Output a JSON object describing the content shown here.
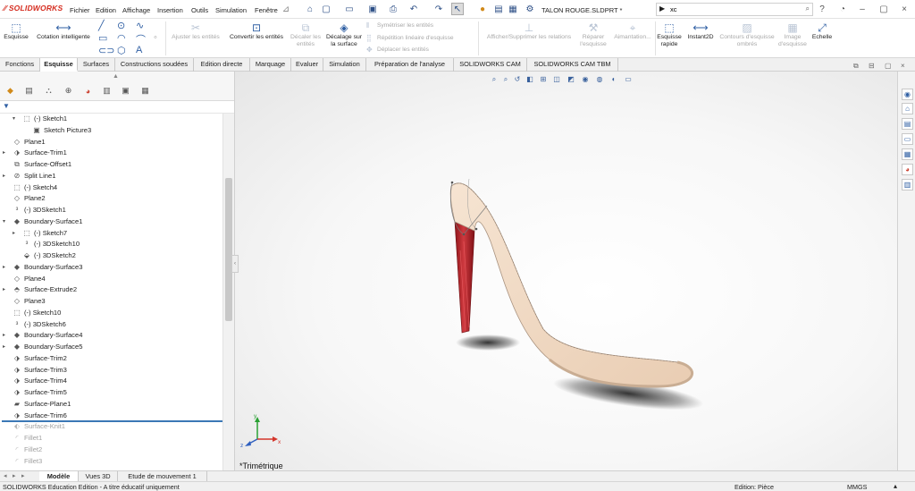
{
  "app": {
    "logo": "SOLIDWORKS",
    "document_title": "TALON ROUGE.SLDPRT *"
  },
  "menu": [
    "Fichier",
    "Edition",
    "Affichage",
    "Insertion",
    "Outils",
    "Simulation",
    "Fenêtre"
  ],
  "search": {
    "value": "xc",
    "placeholder": ""
  },
  "ribbon": {
    "esquisse": "Esquisse",
    "cotation": "Cotation intelligente",
    "ajuster": "Ajuster les entités",
    "convertir": "Convertir les entités",
    "decaler_entites": "Décaler les entités",
    "decalage_surface": "Décalage sur la surface",
    "symetriser": "Symétriser les entités",
    "repetition": "Répétition linéaire d'esquisse",
    "deplacer": "Déplacer les entités",
    "afficher_relations": "Afficher/Supprimer les relations",
    "reparer": "Réparer l'esquisse",
    "aimantation": "Aimantation...",
    "esquisse_rapide": "Esquisse rapide",
    "instant2d": "Instant2D",
    "contours": "Contours d'esquisse ombrés",
    "image_esquisse": "Image d'esquisse",
    "echelle": "Echelle"
  },
  "tabs": [
    "Fonctions",
    "Esquisse",
    "Surfaces",
    "Constructions soudées",
    "Edition directe",
    "Marquage",
    "Evaluer",
    "Simulation",
    "Préparation de l'analyse",
    "SOLIDWORKS CAM",
    "SOLIDWORKS CAM TBM"
  ],
  "active_tab": "Esquisse",
  "tree": [
    {
      "label": "(-) Sketch1",
      "icon": "sketch-icon",
      "arrow": "expanded",
      "indent": 1,
      "state": "normal"
    },
    {
      "label": "Sketch Picture3",
      "icon": "sketch-picture-icon",
      "arrow": "",
      "indent": 2,
      "state": "normal"
    },
    {
      "label": "Plane1",
      "icon": "plane-icon",
      "arrow": "",
      "indent": 0,
      "state": "normal"
    },
    {
      "label": "Surface-Trim1",
      "icon": "surface-trim-icon",
      "arrow": "collapsed",
      "indent": 0,
      "state": "normal"
    },
    {
      "label": "Surface-Offset1",
      "icon": "surface-offset-icon",
      "arrow": "",
      "indent": 0,
      "state": "normal"
    },
    {
      "label": "Split Line1",
      "icon": "split-line-icon",
      "arrow": "collapsed",
      "indent": 0,
      "state": "normal"
    },
    {
      "label": "(-) Sketch4",
      "icon": "sketch-icon",
      "arrow": "",
      "indent": 0,
      "state": "normal"
    },
    {
      "label": "Plane2",
      "icon": "plane-icon",
      "arrow": "",
      "indent": 0,
      "state": "normal"
    },
    {
      "label": "(-) 3DSketch1",
      "icon": "3dsketch-icon",
      "arrow": "",
      "indent": 0,
      "state": "normal"
    },
    {
      "label": "Boundary-Surface1",
      "icon": "boundary-surface-icon",
      "arrow": "expanded",
      "indent": 0,
      "state": "normal"
    },
    {
      "label": "(-) Sketch7",
      "icon": "sketch-icon",
      "arrow": "collapsed",
      "indent": 1,
      "state": "normal"
    },
    {
      "label": "(-) 3DSketch10",
      "icon": "3dsketch-icon",
      "arrow": "",
      "indent": 1,
      "state": "normal"
    },
    {
      "label": "(-) 3DSketch2",
      "icon": "3dsketch-edit-icon",
      "arrow": "",
      "indent": 1,
      "state": "normal"
    },
    {
      "label": "Boundary-Surface3",
      "icon": "boundary-surface-icon",
      "arrow": "collapsed",
      "indent": 0,
      "state": "normal"
    },
    {
      "label": "Plane4",
      "icon": "plane-icon",
      "arrow": "",
      "indent": 0,
      "state": "normal"
    },
    {
      "label": "Surface-Extrude2",
      "icon": "surface-extrude-icon",
      "arrow": "collapsed",
      "indent": 0,
      "state": "normal"
    },
    {
      "label": "Plane3",
      "icon": "plane-icon",
      "arrow": "",
      "indent": 0,
      "state": "normal"
    },
    {
      "label": "(-) Sketch10",
      "icon": "sketch-icon",
      "arrow": "",
      "indent": 0,
      "state": "normal"
    },
    {
      "label": "(-) 3DSketch6",
      "icon": "3dsketch-icon",
      "arrow": "",
      "indent": 0,
      "state": "normal"
    },
    {
      "label": "Boundary-Surface4",
      "icon": "boundary-surface-icon",
      "arrow": "collapsed",
      "indent": 0,
      "state": "normal"
    },
    {
      "label": "Boundary-Surface5",
      "icon": "boundary-surface-icon",
      "arrow": "collapsed",
      "indent": 0,
      "state": "normal"
    },
    {
      "label": "Surface-Trim2",
      "icon": "surface-trim-icon",
      "arrow": "",
      "indent": 0,
      "state": "normal"
    },
    {
      "label": "Surface-Trim3",
      "icon": "surface-trim-icon",
      "arrow": "",
      "indent": 0,
      "state": "normal"
    },
    {
      "label": "Surface-Trim4",
      "icon": "surface-trim-icon",
      "arrow": "",
      "indent": 0,
      "state": "normal"
    },
    {
      "label": "Surface-Trim5",
      "icon": "surface-trim-icon",
      "arrow": "",
      "indent": 0,
      "state": "normal"
    },
    {
      "label": "Surface-Plane1",
      "icon": "surface-plane-icon",
      "arrow": "",
      "indent": 0,
      "state": "normal"
    },
    {
      "label": "Surface-Trim6",
      "icon": "surface-trim-icon",
      "arrow": "",
      "indent": 0,
      "state": "normal"
    },
    {
      "label": "Surface-Knit1",
      "icon": "surface-knit-icon",
      "arrow": "",
      "indent": 0,
      "state": "suppressed"
    },
    {
      "label": "Fillet1",
      "icon": "fillet-icon",
      "arrow": "",
      "indent": 0,
      "state": "suppressed"
    },
    {
      "label": "Fillet2",
      "icon": "fillet-icon",
      "arrow": "",
      "indent": 0,
      "state": "suppressed"
    },
    {
      "label": "Fillet3",
      "icon": "fillet-icon",
      "arrow": "",
      "indent": 0,
      "state": "suppressed"
    }
  ],
  "view_label": "*Trimétrique",
  "triad": {
    "x": "x",
    "y": "y",
    "z": "z"
  },
  "bottom_tabs": [
    "Modèle",
    "Vues 3D",
    "Etude de mouvement 1"
  ],
  "status": {
    "left": "SOLIDWORKS Education Edition - A titre éducatif uniquement",
    "mode": "Edition: Pièce",
    "units": "MMGS"
  },
  "colors": {
    "accent": "#2f5fa3",
    "heel": "#b3252b",
    "sole": "#f0d9c4",
    "brand": "#d52b1e"
  }
}
